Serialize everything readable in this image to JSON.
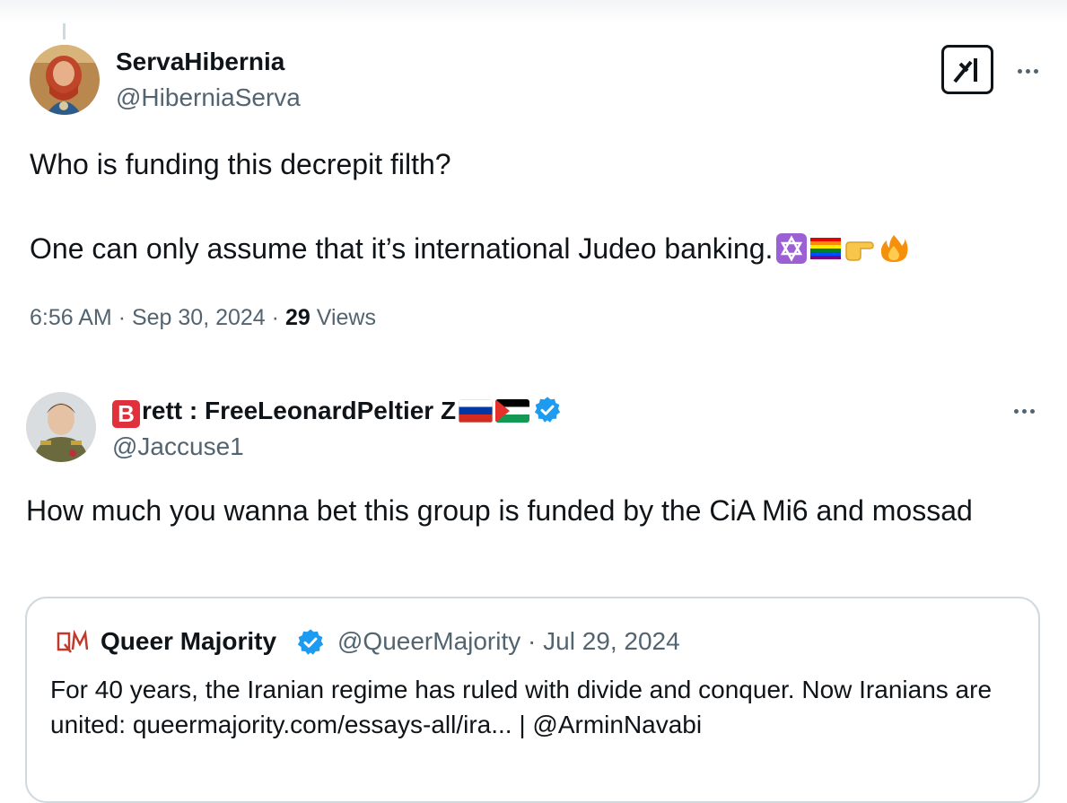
{
  "tweet1": {
    "display_name": "ServaHibernia",
    "handle": "@HiberniaServa",
    "text_line1": "Who is funding this decrepit filth?",
    "text_line2": "One can only assume that it’s international Judeo banking.",
    "emojis": [
      "star-of-david-emoji",
      "rainbow-flag-emoji",
      "pointing-right-emoji",
      "fire-emoji"
    ],
    "time": "6:56 AM",
    "date": "Sep 30, 2024",
    "views_count": "29",
    "views_label": "Views"
  },
  "tweet2": {
    "badge_letter": "B",
    "display_name": "rett : FreeLeonardPeltier Z",
    "flags": [
      "russia-flag",
      "palestine-flag"
    ],
    "handle": "@Jaccuse1",
    "text": "How much you wanna bet this group is funded by the CiA  Mi6 and mossad"
  },
  "quote": {
    "display_name": "Queer Majority",
    "handle_date": "@QueerMajority · Jul 29, 2024",
    "text": "For 40 years, the Iranian regime has ruled with divide and conquer. Now Iranians are united: queermajority.com/essays-all/ira... | @ArminNavabi"
  },
  "colors": {
    "text": "#0f1419",
    "secondary": "#536471",
    "verified_blue": "#1d9bf0",
    "border": "#cfd9de"
  }
}
